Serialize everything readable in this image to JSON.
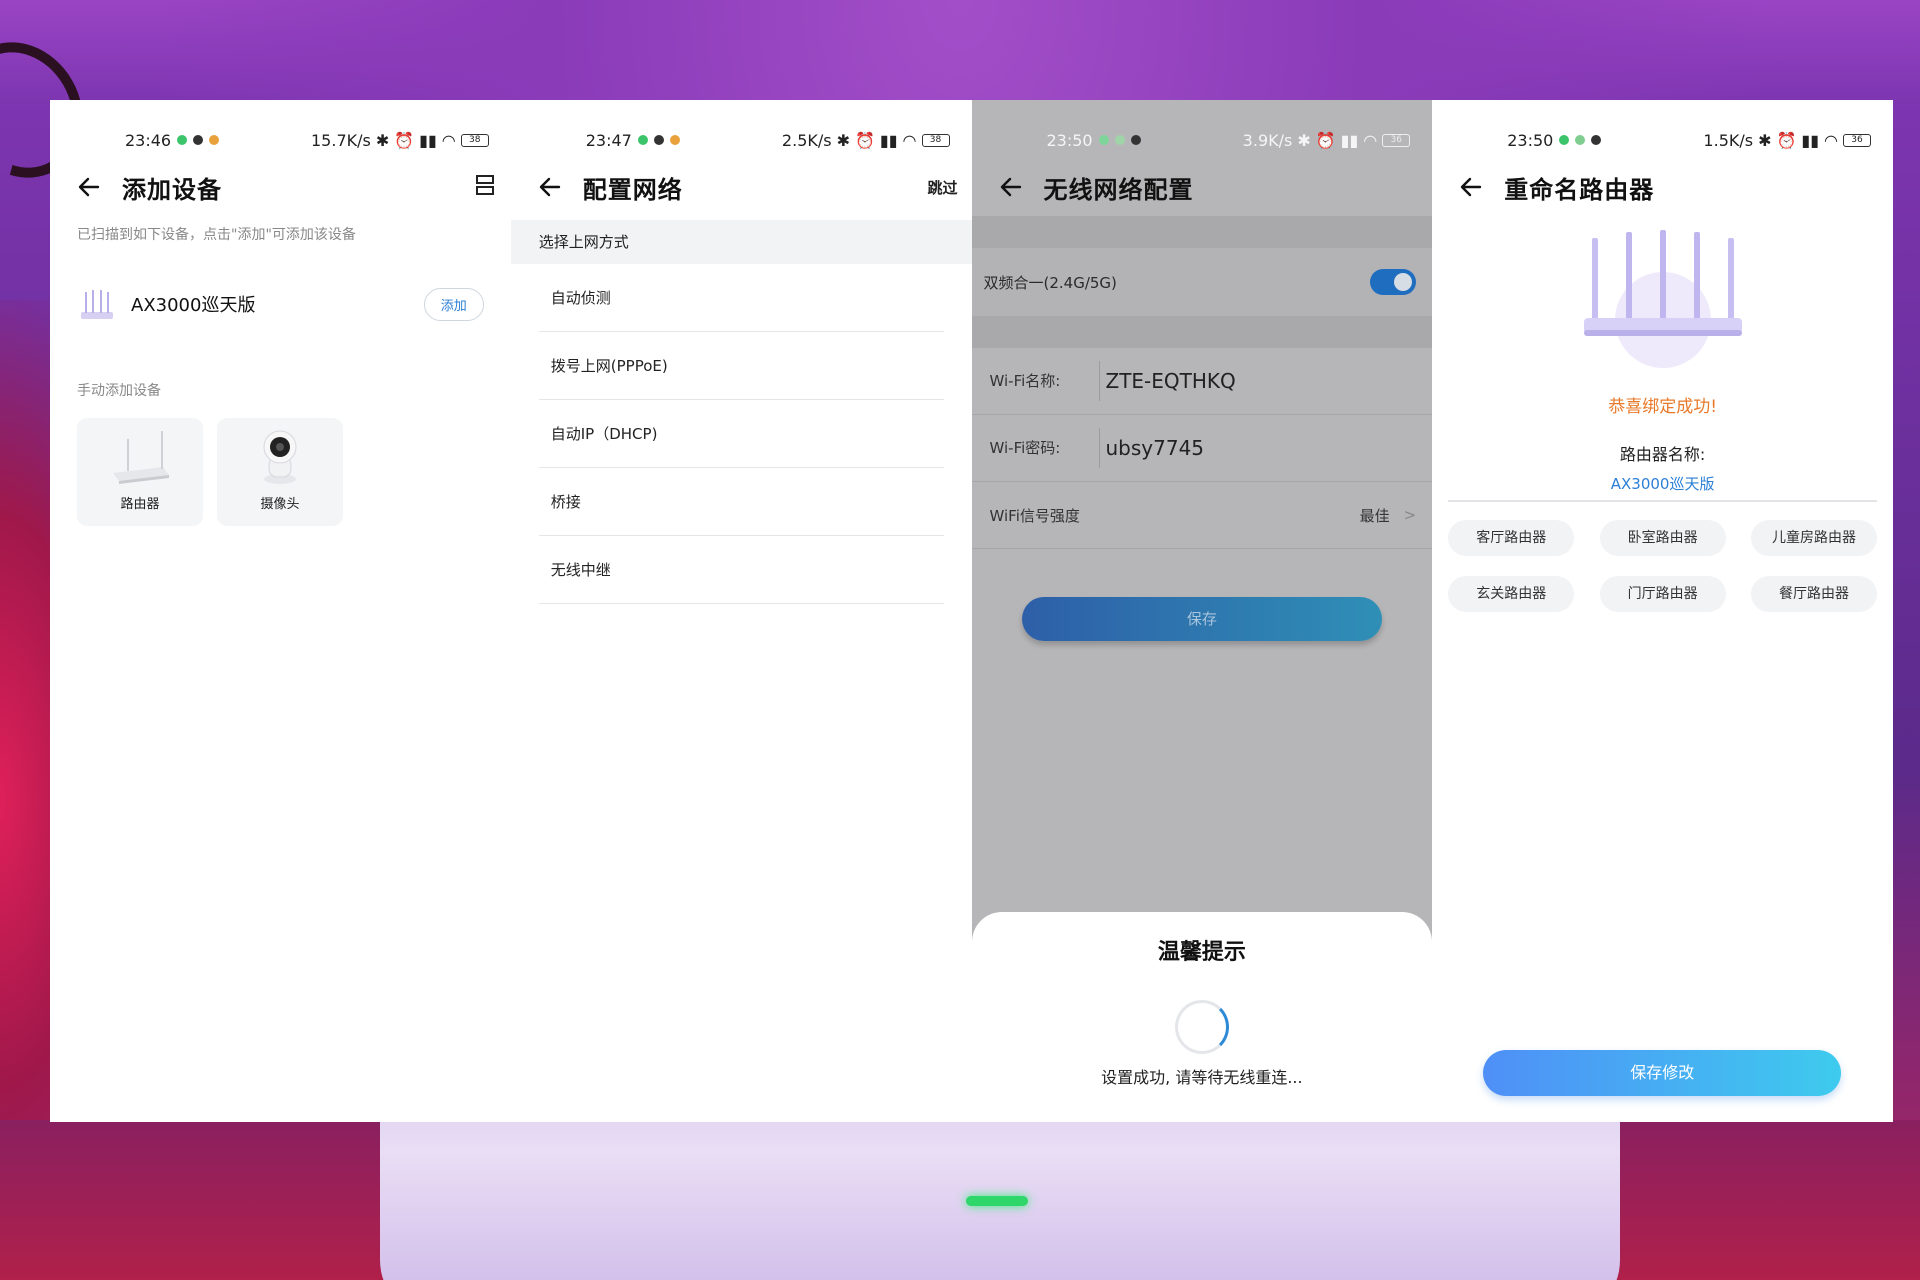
{
  "screens": [
    {
      "status": {
        "time": "23:46",
        "speed": "15.7K/s",
        "battery": "38"
      },
      "title": "添加设备",
      "hint": "已扫描到如下设备，点击\"添加\"可添加该设备",
      "device": {
        "name": "AX3000巡天版",
        "action": "添加"
      },
      "manual_label": "手动添加设备",
      "tiles": [
        {
          "label": "路由器"
        },
        {
          "label": "摄像头"
        }
      ]
    },
    {
      "status": {
        "time": "23:47",
        "speed": "2.5K/s",
        "battery": "38"
      },
      "title": "配置网络",
      "skip": "跳过",
      "section": "选择上网方式",
      "items": [
        "自动侦测",
        "拨号上网(PPPoE)",
        "自动IP（DHCP)",
        "桥接",
        "无线中继"
      ]
    },
    {
      "status": {
        "time": "23:50",
        "speed": "3.9K/s",
        "battery": "36"
      },
      "title": "无线网络配置",
      "dual_band_label": "双频合一(2.4G/5G)",
      "ssid_label": "Wi-Fi名称:",
      "ssid_value": "ZTE-EQTHKQ",
      "pwd_label": "Wi-Fi密码:",
      "pwd_value": "ubsy7745",
      "signal_label": "WiFi信号强度",
      "signal_value": "最佳",
      "save": "保存",
      "dialog": {
        "title": "温馨提示",
        "message": "设置成功, 请等待无线重连..."
      }
    },
    {
      "status": {
        "time": "23:50",
        "speed": "1.5K/s",
        "battery": "36"
      },
      "title": "重命名路由器",
      "success": "恭喜绑定成功!",
      "name_label": "路由器名称:",
      "name_value": "AX3000巡天版",
      "chips": [
        "客厅路由器",
        "卧室路由器",
        "儿童房路由器",
        "玄关路由器",
        "门厅路由器",
        "餐厅路由器"
      ],
      "save": "保存修改"
    }
  ],
  "colors": {
    "accent": "#2b7fd6",
    "success": "#e8792a",
    "toggle": "#1f6dbf"
  }
}
